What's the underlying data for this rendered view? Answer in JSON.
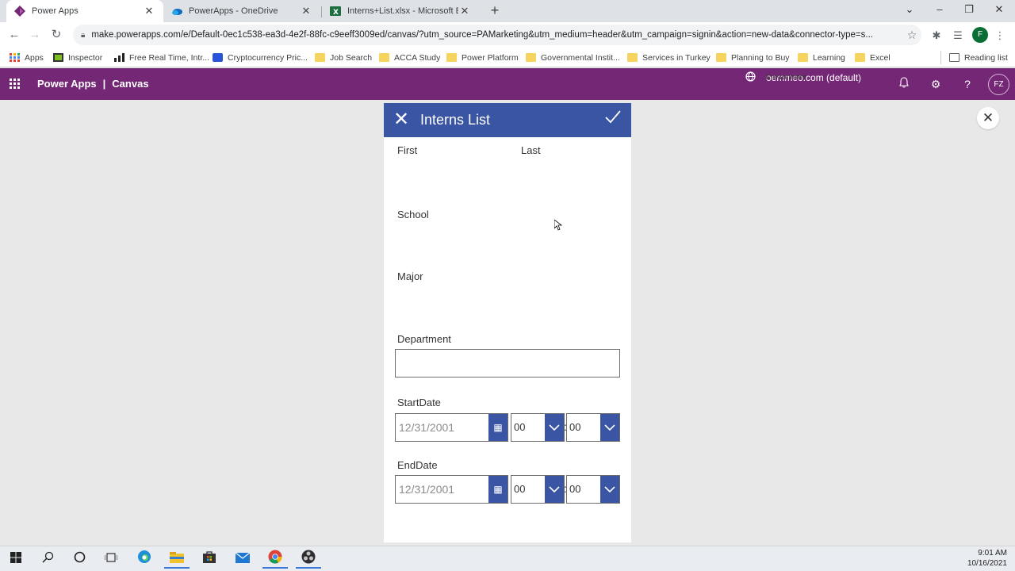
{
  "browser": {
    "tabs": [
      {
        "title": "Power Apps",
        "active": true,
        "icon": "powerapps-icon"
      },
      {
        "title": "PowerApps - OneDrive",
        "active": false,
        "icon": "onedrive-icon"
      },
      {
        "title": "Interns+List.xlsx - Microsoft Excel",
        "active": false,
        "icon": "excel-icon"
      }
    ],
    "url": "make.powerapps.com/e/Default-0ec1c538-ea3d-4e2f-88fc-c9eeff3009ed/canvas/?utm_source=PAMarketing&utm_medium=header&utm_campaign=signin&action=new-data&connector-type=s...",
    "profile_initial": "F",
    "bookmarks": [
      {
        "label": "Apps",
        "icon": "apps-grid-icon"
      },
      {
        "label": "Inspector",
        "icon": "inspector-icon"
      },
      {
        "label": "Free Real Time, Intr...",
        "icon": "chart-icon"
      },
      {
        "label": "Cryptocurrency Pric...",
        "icon": "crypto-icon"
      },
      {
        "label": "Job Search",
        "icon": "folder-icon"
      },
      {
        "label": "ACCA Study",
        "icon": "folder-icon"
      },
      {
        "label": "Power Platform",
        "icon": "folder-icon"
      },
      {
        "label": "Governmental Instit...",
        "icon": "folder-icon"
      },
      {
        "label": "Services in Turkey",
        "icon": "folder-icon"
      },
      {
        "label": "Planning to Buy",
        "icon": "folder-icon"
      },
      {
        "label": "Learning",
        "icon": "folder-icon"
      },
      {
        "label": "Excel",
        "icon": "folder-icon"
      }
    ],
    "reading_list": "Reading list"
  },
  "header": {
    "product": "Power Apps",
    "separator": "|",
    "section": "Canvas",
    "environment_label": "Environment",
    "environment_value": "oemmeo.com (default)",
    "user_initials": "FZ"
  },
  "form": {
    "title": "Interns List",
    "fields": {
      "first": "First",
      "last": "Last",
      "school": "School",
      "major": "Major",
      "department": "Department",
      "start_date": "StartDate",
      "end_date": "EndDate"
    },
    "start": {
      "date": "12/31/2001",
      "hour": "00",
      "minute": "00"
    },
    "end": {
      "date": "12/31/2001",
      "hour": "00",
      "minute": "00"
    },
    "time_separator": ":"
  },
  "taskbar": {
    "time": "9:01 AM",
    "date": "10/16/2021"
  },
  "colors": {
    "powerapps_purple": "#742774",
    "form_header_blue": "#3955a3"
  }
}
